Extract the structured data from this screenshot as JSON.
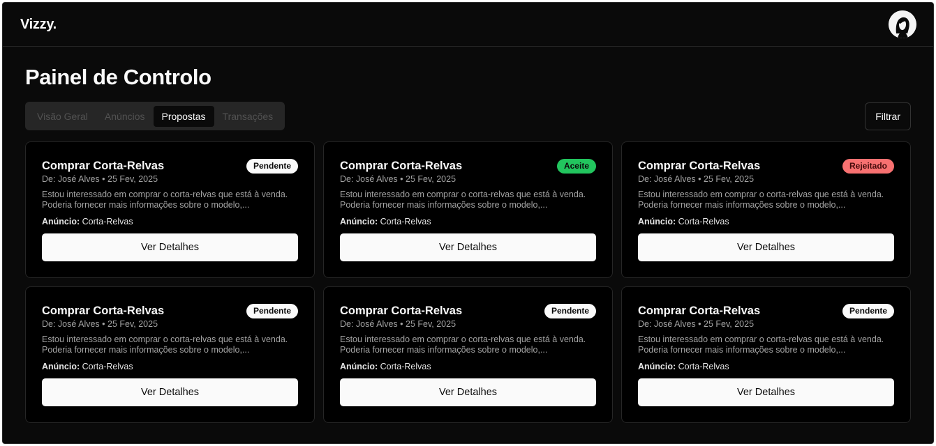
{
  "header": {
    "brand": "Vizzy.",
    "avatar_icon": "user-avatar-icon"
  },
  "page": {
    "title": "Painel de Controlo",
    "filter_label": "Filtrar"
  },
  "tabs": [
    {
      "label": "Visão Geral",
      "active": false
    },
    {
      "label": "Anúncios",
      "active": false
    },
    {
      "label": "Propostas",
      "active": true
    },
    {
      "label": "Transações",
      "active": false
    }
  ],
  "status_colors": {
    "Pendente": {
      "bg": "#fafafa",
      "fg": "#0a0a0a"
    },
    "Aceite": {
      "bg": "#22c55e",
      "fg": "#0a0a0a"
    },
    "Rejeitado": {
      "bg": "#f87171",
      "fg": "#450a0a"
    }
  },
  "cards": [
    {
      "title": "Comprar Corta-Relvas",
      "status": "Pendente",
      "meta": "De: José Alves • 25 Fev, 2025",
      "description_line1": "Estou interessado em comprar o corta-relvas que está à venda.",
      "description_line2": "Poderia fornecer mais informações sobre o modelo,...",
      "listing_label": "Anúncio:",
      "listing_value": "Corta-Relvas",
      "button_label": "Ver Detalhes"
    },
    {
      "title": "Comprar Corta-Relvas",
      "status": "Aceite",
      "meta": "De: José Alves • 25 Fev, 2025",
      "description_line1": "Estou interessado em comprar o corta-relvas que está à venda.",
      "description_line2": "Poderia fornecer mais informações sobre o modelo,...",
      "listing_label": "Anúncio:",
      "listing_value": "Corta-Relvas",
      "button_label": "Ver Detalhes"
    },
    {
      "title": "Comprar Corta-Relvas",
      "status": "Rejeitado",
      "meta": "De: José Alves • 25 Fev, 2025",
      "description_line1": "Estou interessado em comprar o corta-relvas que está à venda.",
      "description_line2": "Poderia fornecer mais informações sobre o modelo,...",
      "listing_label": "Anúncio:",
      "listing_value": "Corta-Relvas",
      "button_label": "Ver Detalhes"
    },
    {
      "title": "Comprar Corta-Relvas",
      "status": "Pendente",
      "meta": "De: José Alves • 25 Fev, 2025",
      "description_line1": "Estou interessado em comprar o corta-relvas que está à venda.",
      "description_line2": "Poderia fornecer mais informações sobre o modelo,...",
      "listing_label": "Anúncio:",
      "listing_value": "Corta-Relvas",
      "button_label": "Ver Detalhes"
    },
    {
      "title": "Comprar Corta-Relvas",
      "status": "Pendente",
      "meta": "De: José Alves • 25 Fev, 2025",
      "description_line1": "Estou interessado em comprar o corta-relvas que está à venda.",
      "description_line2": "Poderia fornecer mais informações sobre o modelo,...",
      "listing_label": "Anúncio:",
      "listing_value": "Corta-Relvas",
      "button_label": "Ver Detalhes"
    },
    {
      "title": "Comprar Corta-Relvas",
      "status": "Pendente",
      "meta": "De: José Alves • 25 Fev, 2025",
      "description_line1": "Estou interessado em comprar o corta-relvas que está à venda.",
      "description_line2": "Poderia fornecer mais informações sobre o modelo,...",
      "listing_label": "Anúncio:",
      "listing_value": "Corta-Relvas",
      "button_label": "Ver Detalhes"
    }
  ]
}
